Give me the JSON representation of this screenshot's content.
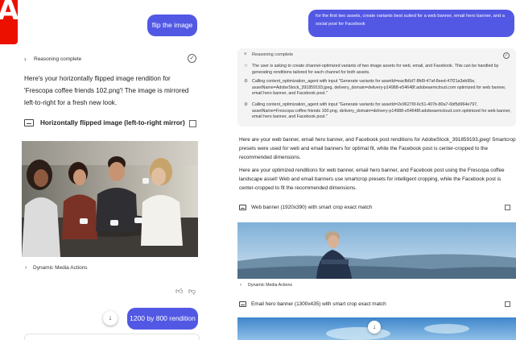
{
  "left": {
    "user_message": "flip the image",
    "reasoning_label": "Reasoning complete",
    "response_text": "Here's your horizontally flipped image rendition for 'Frescopa coffee friends 102.png'! The image is mirrored left-to-right for a fresh new look.",
    "card_title": "Horizontally flipped image (left-to-right mirror)",
    "dm_actions_label": "Dynamic Media Actions",
    "suggestion_label": "1200 by 800 rendition"
  },
  "right": {
    "user_message": "for the first two assets, create variants best suited for a web banner, email hero banner, and a social post for Facebook",
    "reasoning_label": "Reasoning complete",
    "reasoning_lines": [
      "The user is asking to create channel-optimized variants of two image assets for web, email, and Facebook. This can be handled by generating renditions tailored for each channel for both assets.",
      "Calling content_optimization_agent with input \"Generate variants for assetId=eacfb6d7-8fd9-47af-8eed-47f21a3eb95e, assetName=AdobeStock_391859193.jpeg, delivery_domain=delivery-p14988-e54648f.adobeaemcloud.com optimized for web banner, email hero banner, and Facebook post.\"",
      "Calling content_optimization_agent with input \"Generate variants for assetId=2e96276f-6c51-407b-80a7-6bf5d964e797, assetName=Frescopa coffee friends 100.png, delivery_domain=delivery-p14988-e54648f.adobeaemcloud.com optimized for web banner, email hero banner, and Facebook post.\""
    ],
    "para1": "Here are your web banner, email hero banner, and Facebook post renditions for AdobeStock_391859193.jpeg! Smartcrop presets were used for web and email banners for optimal fit, while the Facebook post is center-cropped to the recommended dimensions.",
    "para2": "Here are your optimized renditions for web banner, email hero banner, and Facebook post using the Frescopa coffee landscape asset! Web and email banners use smartcrop presets for intelligent cropping, while the Facebook post is center-cropped to fit the recommended dimensions.",
    "card1_title": "Web banner (1920x390) with smart crop exact match",
    "dm_actions_label": "Dynamic Media Actions",
    "card2_title": "Email hero banner (1300x435) with smart crop exact match"
  },
  "colors": {
    "accent": "#5258e4",
    "brand": "#eb1000"
  },
  "icons": [
    "adobe-logo",
    "chevron-right-icon",
    "chevron-down-icon",
    "check-circle-icon",
    "image-icon",
    "open-external-icon",
    "thumbs-up-icon",
    "thumbs-down-icon",
    "arrow-down-icon",
    "agent-icon",
    "tool-icon"
  ]
}
